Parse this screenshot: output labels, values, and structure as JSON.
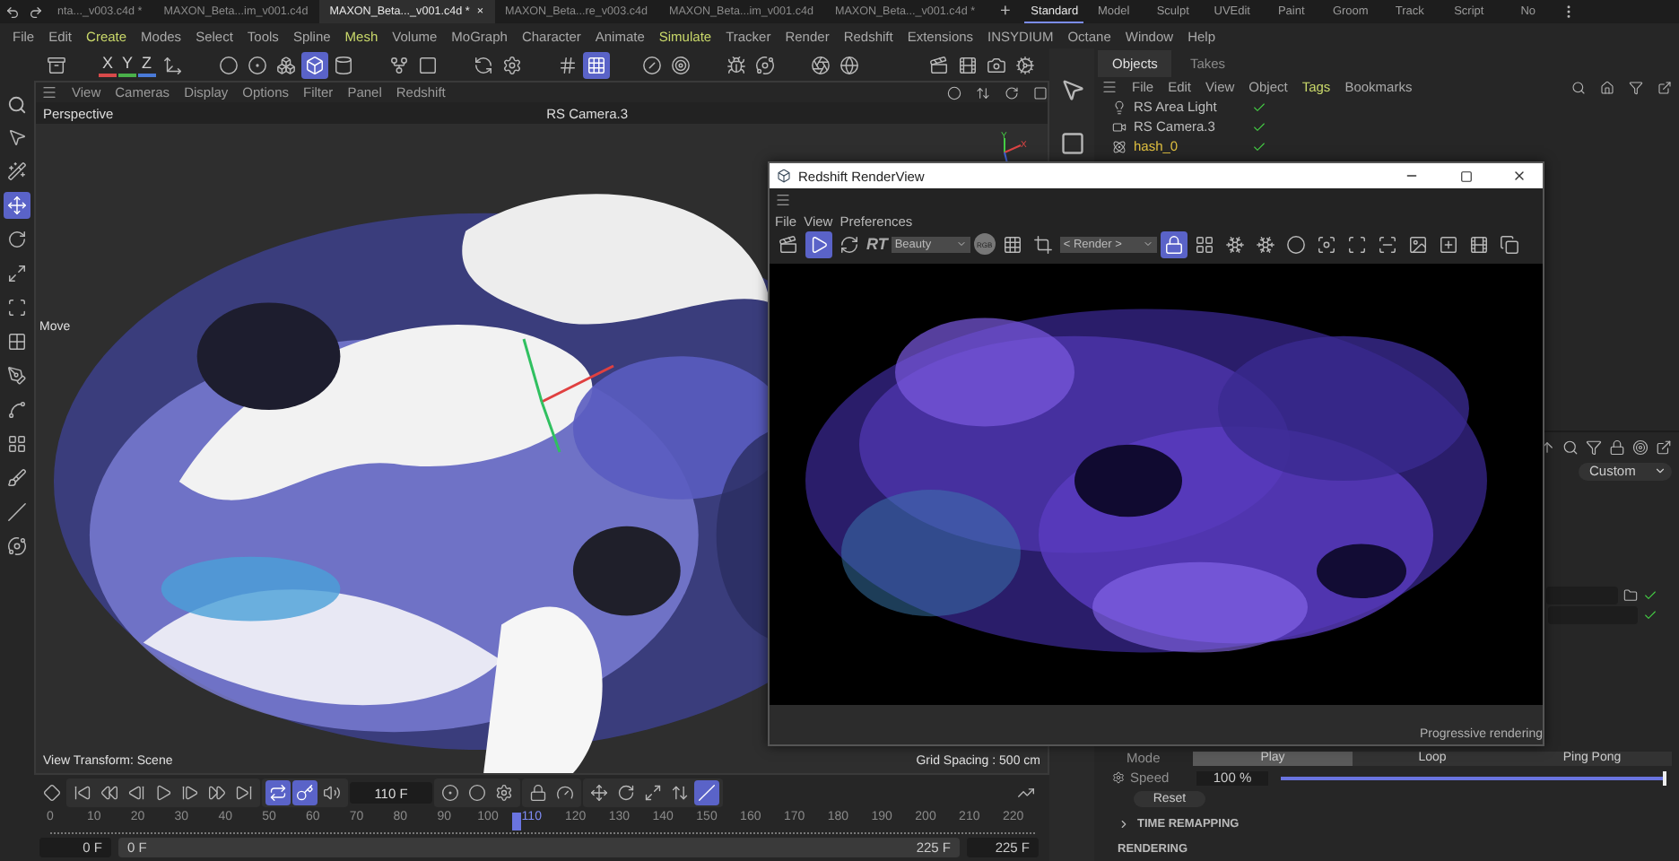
{
  "file_tabs": [
    {
      "label": "nta..._v003.c4d *",
      "selected": false
    },
    {
      "label": "MAXON_Beta...im_v001.c4d",
      "selected": false
    },
    {
      "label": "MAXON_Beta..._v001.c4d *",
      "selected": true,
      "close": "×"
    },
    {
      "label": "MAXON_Beta...re_v003.c4d",
      "selected": false
    },
    {
      "label": "MAXON_Beta...im_v001.c4d",
      "selected": false
    },
    {
      "label": "MAXON_Beta..._v001.c4d *",
      "selected": false
    }
  ],
  "new_tab": "+",
  "layouts": [
    {
      "label": "Standard",
      "selected": true
    },
    {
      "label": "Model",
      "selected": false
    },
    {
      "label": "Sculpt",
      "selected": false
    },
    {
      "label": "UVEdit",
      "selected": false
    },
    {
      "label": "Paint",
      "selected": false
    },
    {
      "label": "Groom",
      "selected": false
    },
    {
      "label": "Track",
      "selected": false
    },
    {
      "label": "Script",
      "selected": false
    },
    {
      "label": "No",
      "selected": false
    }
  ],
  "menu": [
    {
      "label": "File",
      "highlighted": false
    },
    {
      "label": "Edit",
      "highlighted": false
    },
    {
      "label": "Create",
      "highlighted": true
    },
    {
      "label": "Modes",
      "highlighted": false
    },
    {
      "label": "Select",
      "highlighted": false
    },
    {
      "label": "Tools",
      "highlighted": false
    },
    {
      "label": "Spline",
      "highlighted": false
    },
    {
      "label": "Mesh",
      "highlighted": true
    },
    {
      "label": "Volume",
      "highlighted": false
    },
    {
      "label": "MoGraph",
      "highlighted": false
    },
    {
      "label": "Character",
      "highlighted": false
    },
    {
      "label": "Animate",
      "highlighted": false
    },
    {
      "label": "Simulate",
      "highlighted": true
    },
    {
      "label": "Tracker",
      "highlighted": false
    },
    {
      "label": "Render",
      "highlighted": false
    },
    {
      "label": "Redshift",
      "highlighted": false
    },
    {
      "label": "Extensions",
      "highlighted": false
    },
    {
      "label": "INSYDIUM",
      "highlighted": false
    },
    {
      "label": "Octane",
      "highlighted": false
    },
    {
      "label": "Window",
      "highlighted": false
    },
    {
      "label": "Help",
      "highlighted": false
    }
  ],
  "axis_locks": [
    {
      "label": "X",
      "color": "#d84a4a"
    },
    {
      "label": "Y",
      "color": "#4ab04a"
    },
    {
      "label": "Z",
      "color": "#4a7ad8"
    }
  ],
  "main_toolbar": [
    {
      "active": false
    },
    {
      "active": false
    },
    {
      "active": false
    },
    {
      "active": false
    },
    {
      "active": false
    },
    {
      "active": true
    },
    {
      "active": false
    },
    {
      "active": false
    },
    {
      "active": false
    },
    {
      "active": false
    },
    {
      "active": false
    },
    {
      "active": false
    },
    {
      "active": true
    },
    {
      "active": false
    },
    {
      "active": false
    },
    {
      "active": false
    },
    {
      "active": false
    },
    {
      "active": false
    },
    {
      "active": false
    },
    {
      "active": false
    },
    {
      "active": false
    },
    {
      "active": false
    }
  ],
  "tools": [
    {
      "active": false
    },
    {
      "active": false
    },
    {
      "active": true
    },
    {
      "active": false
    },
    {
      "active": false
    },
    {
      "active": false
    },
    {
      "active": false
    },
    {
      "active": false
    },
    {
      "active": false
    },
    {
      "active": false
    },
    {
      "active": false
    },
    {
      "active": false
    },
    {
      "active": false
    }
  ],
  "viewport": {
    "menu": [
      "View",
      "Cameras",
      "Display",
      "Options",
      "Filter",
      "Panel",
      "Redshift"
    ],
    "view_name": "Perspective",
    "camera": "RS Camera.3",
    "tool_label": "Move",
    "axes": [
      "Y",
      "X"
    ],
    "view_transform": "View Transform: Scene",
    "grid_spacing": "Grid Spacing : 500 cm"
  },
  "render_view": {
    "title": "Redshift RenderView",
    "menu": [
      "File",
      "View",
      "Preferences"
    ],
    "rt": "RT",
    "aov": "Beauty",
    "channel": "RGB",
    "camera_select": "< Render >",
    "toolbar": [
      {
        "active": false
      },
      {
        "active": true
      },
      {
        "active": false
      },
      {
        "active": false
      },
      {
        "active": false
      },
      {
        "active": true
      },
      {
        "active": false
      },
      {
        "active": false
      },
      {
        "active": false
      },
      {
        "active": false
      },
      {
        "active": false
      },
      {
        "active": false
      },
      {
        "active": false
      },
      {
        "active": false
      },
      {
        "active": false
      },
      {
        "active": false
      },
      {
        "active": false
      }
    ],
    "status": "Progressive rendering"
  },
  "objects_panel": {
    "tabs": [
      {
        "label": "Objects",
        "selected": true
      },
      {
        "label": "Takes",
        "selected": false
      }
    ],
    "menu": [
      {
        "label": "File",
        "highlighted": false
      },
      {
        "label": "Edit",
        "highlighted": false
      },
      {
        "label": "View",
        "highlighted": false
      },
      {
        "label": "Object",
        "highlighted": false
      },
      {
        "label": "Tags",
        "highlighted": true
      },
      {
        "label": "Bookmarks",
        "highlighted": false
      }
    ],
    "objects": [
      {
        "name": "RS Area Light",
        "kind": "light",
        "selected": false
      },
      {
        "name": "RS Camera.3",
        "kind": "camera",
        "selected": false
      },
      {
        "name": "hash_0",
        "kind": "emitter",
        "selected": true
      }
    ]
  },
  "attributes": {
    "preset": "Custom",
    "mode_label": "Mode",
    "modes": [
      {
        "label": "Play",
        "selected": true
      },
      {
        "label": "Loop",
        "selected": false
      },
      {
        "label": "Ping Pong",
        "selected": false
      }
    ],
    "speed_label": "Speed",
    "speed": "100 %",
    "speed_slider": {
      "level": 1
    },
    "reset": "Reset",
    "sections": [
      {
        "title": "TIME REMAPPING",
        "expanded": false
      },
      {
        "title": "RENDERING",
        "expanded": true
      }
    ]
  },
  "timeline": {
    "current_frame": "110 F",
    "buttons": [
      {
        "active": false
      },
      {
        "active": false
      },
      {
        "active": false
      },
      {
        "active": false
      },
      {
        "active": false
      },
      {
        "active": false
      },
      {
        "active": false
      },
      {
        "active": false
      },
      {
        "active": true
      },
      {
        "active": true
      },
      {
        "active": false
      },
      {
        "active": false
      },
      {
        "active": false
      },
      {
        "active": false
      },
      {
        "active": false
      },
      {
        "active": false
      },
      {
        "active": false
      },
      {
        "active": false
      },
      {
        "active": false
      },
      {
        "active": false
      },
      {
        "active": true
      },
      {
        "active": false
      }
    ],
    "ruler": [
      {
        "label": "0",
        "current": false
      },
      {
        "label": "10",
        "current": false
      },
      {
        "label": "20",
        "current": false
      },
      {
        "label": "30",
        "current": false
      },
      {
        "label": "40",
        "current": false
      },
      {
        "label": "50",
        "current": false
      },
      {
        "label": "60",
        "current": false
      },
      {
        "label": "70",
        "current": false
      },
      {
        "label": "80",
        "current": false
      },
      {
        "label": "90",
        "current": false
      },
      {
        "label": "100",
        "current": false
      },
      {
        "label": "110",
        "current": true
      },
      {
        "label": "120",
        "current": false
      },
      {
        "label": "130",
        "current": false
      },
      {
        "label": "140",
        "current": false
      },
      {
        "label": "150",
        "current": false
      },
      {
        "label": "160",
        "current": false
      },
      {
        "label": "170",
        "current": false
      },
      {
        "label": "180",
        "current": false
      },
      {
        "label": "190",
        "current": false
      },
      {
        "label": "200",
        "current": false
      },
      {
        "label": "210",
        "current": false
      },
      {
        "label": "220",
        "current": false
      }
    ],
    "playhead": {
      "level": 0.489
    },
    "range": {
      "start": "0 F",
      "min": "0 F",
      "max": "225 F",
      "end": "225 F"
    }
  }
}
